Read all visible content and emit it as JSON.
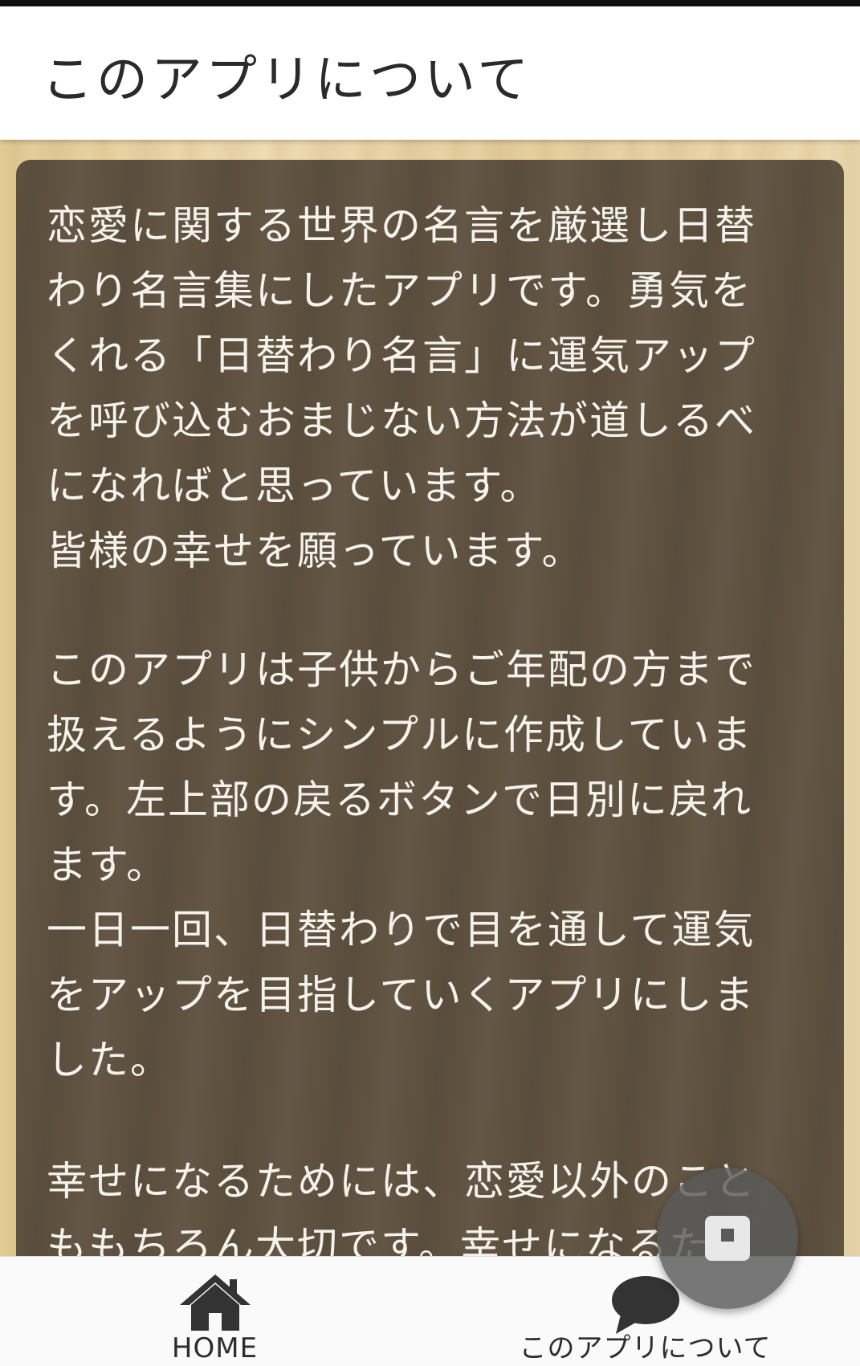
{
  "header": {
    "title": "このアプリについて"
  },
  "content": {
    "paragraphs": [
      "恋愛に関する世界の名言を厳選し日替\nわり名言集にしたアプリです。勇気を\nくれる「日替わり名言」に運気アップ\nを呼び込むおまじない方法が道しるべ\nになればと思っています。\n皆様の幸せを願っています。",
      "このアプリは子供からご年配の方まで\n扱えるようにシンプルに作成していま\nす。左上部の戻るボタンで日別に戻れ\nます。\n一日一回、日替わりで目を通して運気\nをアップを目指していくアプリにしま\nした。",
      "幸せになるためには、恋愛以外のこと\nももちろん大切です。幸せになるため"
    ]
  },
  "bottom_nav": {
    "items": [
      {
        "label": "HOME",
        "icon": "home-icon"
      },
      {
        "label": "このアプリについて",
        "icon": "speech-bubble-icon"
      }
    ]
  },
  "fab": {
    "icon": "square-icon"
  },
  "colors": {
    "panel": "#5e5140",
    "wood": "#e9d4a6",
    "text_light": "#f5f2ec",
    "nav_icon": "#333333"
  }
}
